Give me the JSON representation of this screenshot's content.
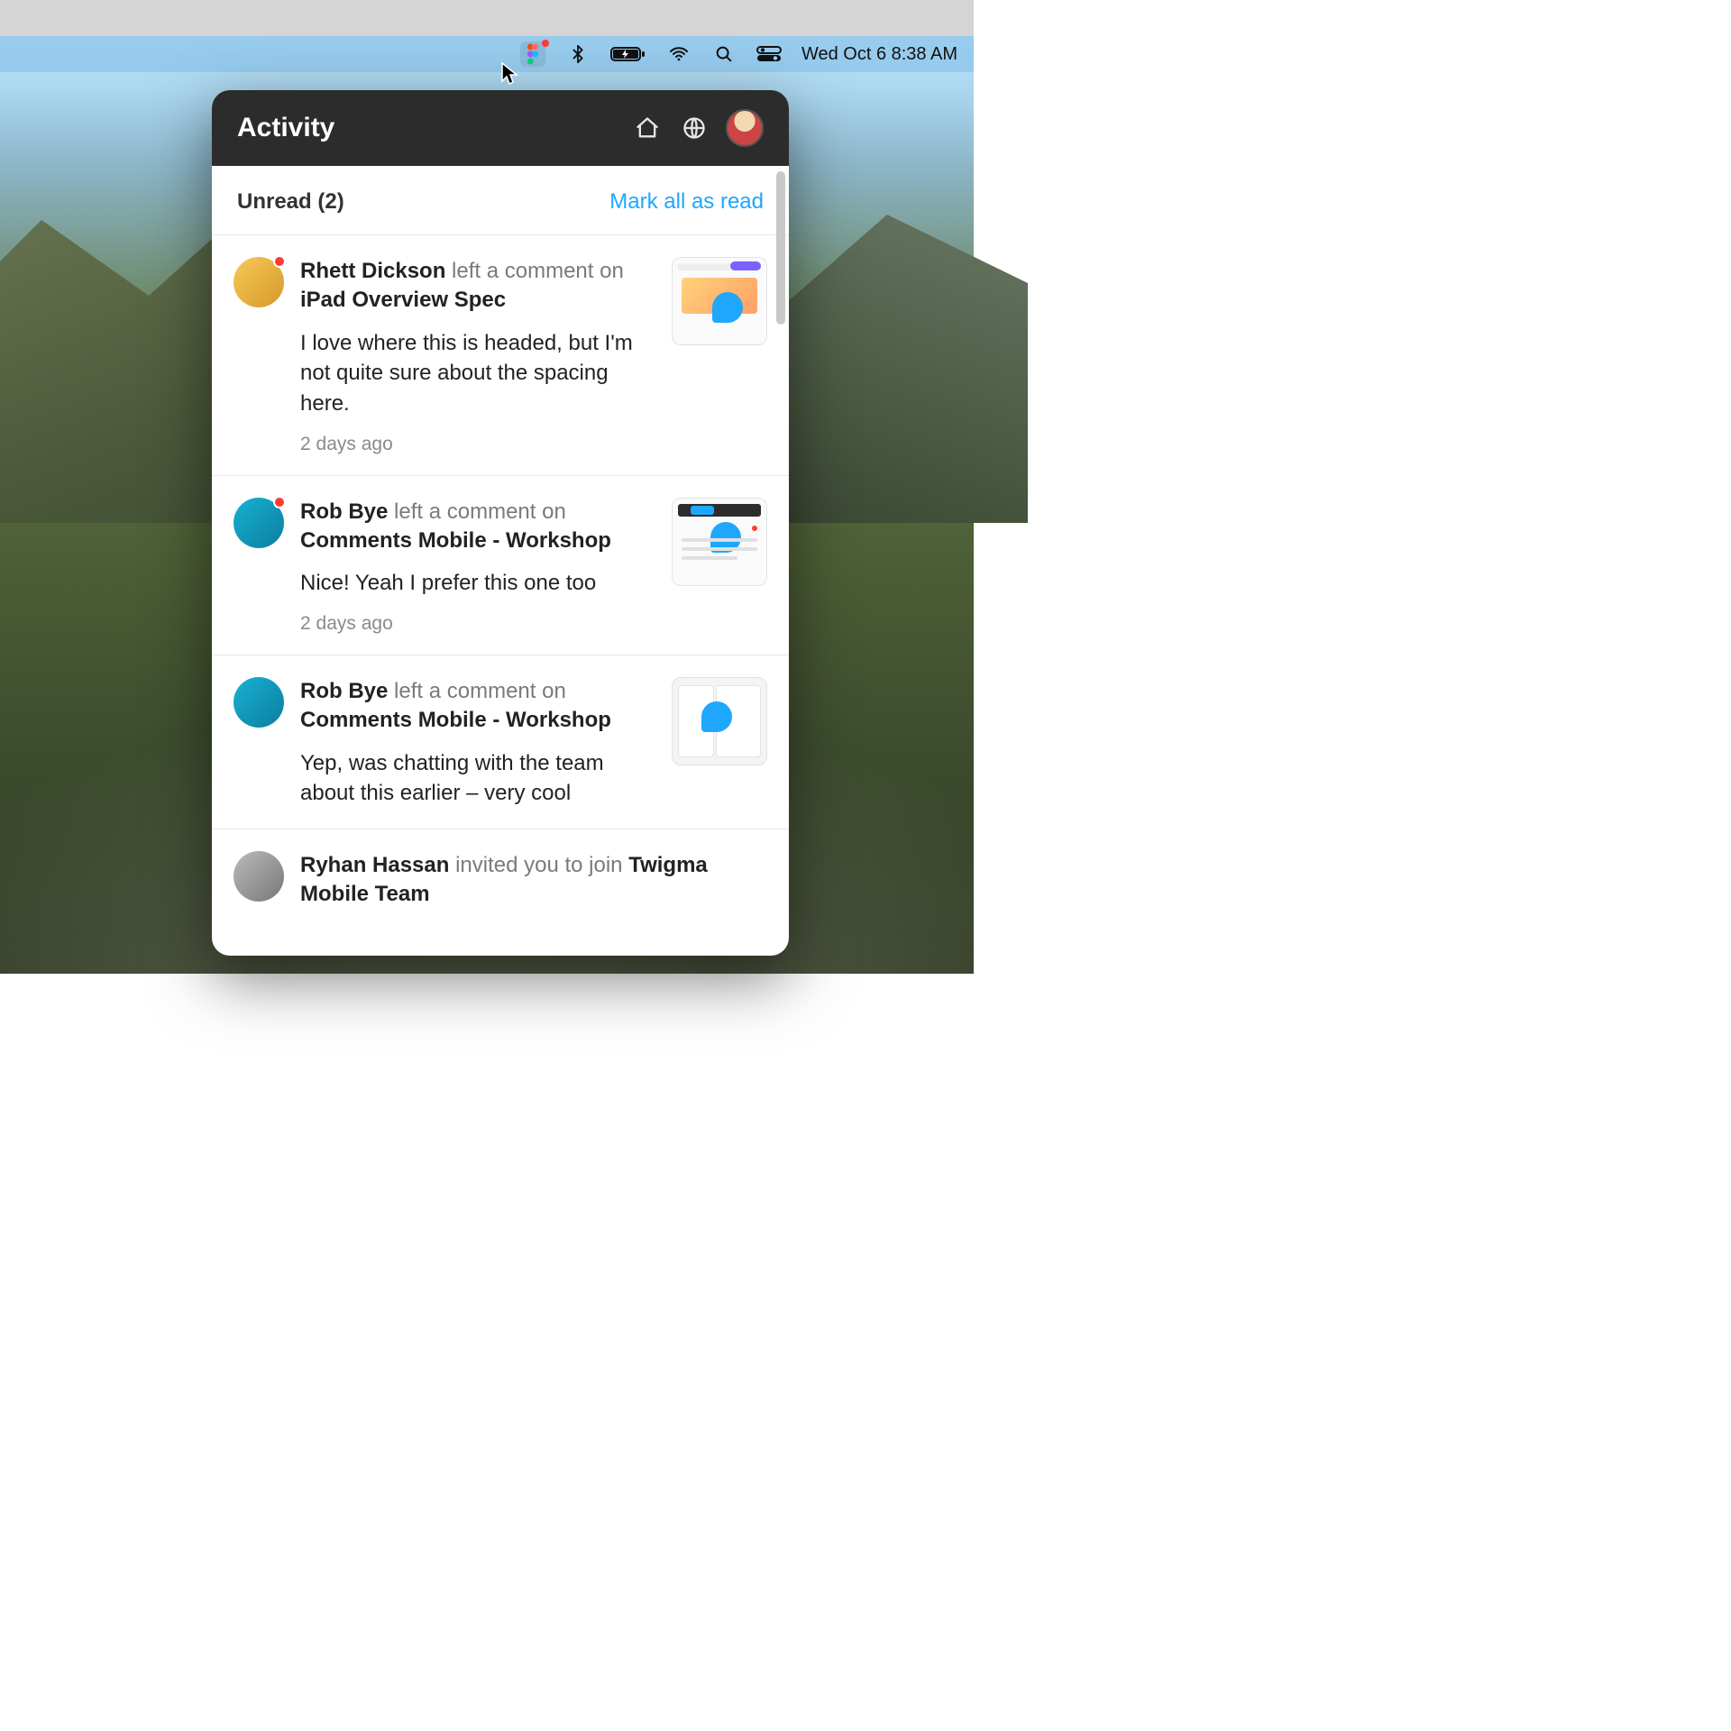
{
  "menubar": {
    "datetime": "Wed Oct 6  8:38 AM",
    "icons": {
      "figma": "figma-icon",
      "bluetooth": "bluetooth-icon",
      "battery": "battery-charging-icon",
      "wifi": "wifi-icon",
      "search": "search-icon",
      "control_center": "control-center-icon"
    }
  },
  "popover": {
    "title": "Activity",
    "header_icons": {
      "home": "home-icon",
      "globe": "globe-icon",
      "avatar": "user-avatar"
    },
    "unread_label": "Unread (2)",
    "mark_all_label": "Mark all as read",
    "items": [
      {
        "unread": true,
        "author": "Rhett Dickson",
        "action": "left a comment on",
        "file": "iPad Overview Spec",
        "comment": "I love where this is headed, but I'm not quite sure about the spacing here.",
        "time": "2 days ago"
      },
      {
        "unread": true,
        "author": "Rob Bye",
        "action": "left a comment on",
        "file": "Comments Mobile - Workshop",
        "comment": "Nice! Yeah I prefer this one too",
        "time": "2 days ago"
      },
      {
        "unread": false,
        "author": "Rob Bye",
        "action": "left a comment on",
        "file": "Comments Mobile - Workshop",
        "comment": "Yep, was chatting with the team about this earlier – very cool",
        "time": ""
      },
      {
        "unread": false,
        "author": "Ryhan Hassan",
        "action": "invited you to join",
        "file": "Twigma Mobile Team",
        "comment": "",
        "time": ""
      }
    ]
  }
}
